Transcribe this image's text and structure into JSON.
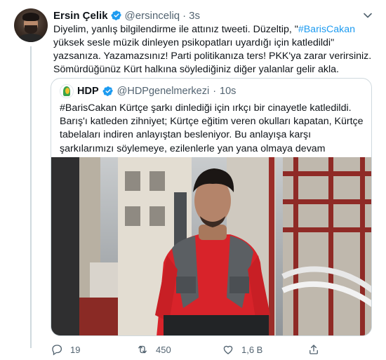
{
  "tweet": {
    "author_name": "Ersin Çelik",
    "author_handle": "@ersinceliq",
    "separator": "·",
    "time": "3s",
    "text_parts": {
      "p1": "Diyelim, yanlış bilgilendirme ile attınız tweeti. Düzeltip, \"",
      "hashtag": "#BarisCakan",
      "p2": " yüksek sesle müzik dinleyen psikopatları uyardığı için katledildi\" yazsanıza. Yazamazsınız! Parti politikanıza ters! PKK'ya zarar verirsiniz. Sömürdüğünüz Kürt halkına söylediğiniz diğer yalanlar gelir akla."
    }
  },
  "quoted": {
    "author_name": "HDP",
    "author_handle": "@HDPgenelmerkezi",
    "separator": "·",
    "time": "10s",
    "text": "#BarisCakan Kürtçe şarkı dinlediği için ırkçı bir cinayetle katledildi. Barış'ı katleden zihniyet; Kürtçe eğitim veren okulları kapatan, Kürtçe tabelaları indiren anlayıştan besleniyor. Bu anlayışa karşı şarkılarımızı söylemeye, ezilenlerle yan yana olmaya devam edeceğiz."
  },
  "actions": {
    "reply_count": "19",
    "retweet_count": "450",
    "like_count": "1,6 B"
  },
  "colors": {
    "accent": "#1d9bf0",
    "secondary_text": "#536471",
    "border": "#cfd9de"
  },
  "icons": [
    "verified-badge-icon",
    "chevron-down-icon",
    "reply-icon",
    "retweet-icon",
    "like-icon",
    "share-icon"
  ]
}
